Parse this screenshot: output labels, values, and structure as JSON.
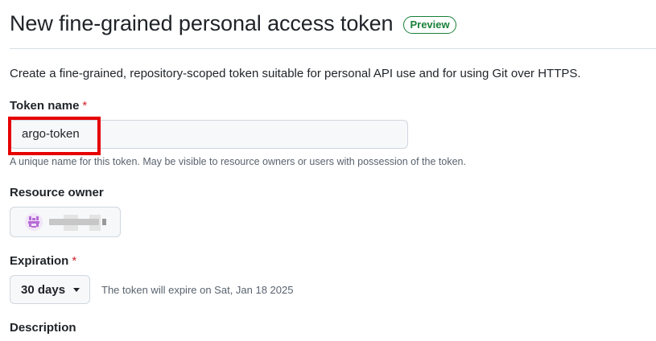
{
  "header": {
    "title": "New fine-grained personal access token",
    "badge": "Preview"
  },
  "intro": "Create a fine-grained, repository-scoped token suitable for personal API use and for using Git over HTTPS.",
  "token_name": {
    "label": "Token name",
    "required_mark": "*",
    "value": "argo-token",
    "help": "A unique name for this token. May be visible to resource owners or users with possession of the token."
  },
  "resource_owner": {
    "label": "Resource owner"
  },
  "expiration": {
    "label": "Expiration",
    "required_mark": "*",
    "selected": "30 days",
    "note": "The token will expire on Sat, Jan 18 2025"
  },
  "description": {
    "label": "Description"
  },
  "colors": {
    "badge_green": "#1a7f37",
    "required_red": "#d1242f",
    "highlight_red": "#e60000",
    "avatar_purple": "#b66bd6"
  },
  "icons": {
    "avatar": "identicon-avatar",
    "dropdown": "caret-down-icon"
  }
}
